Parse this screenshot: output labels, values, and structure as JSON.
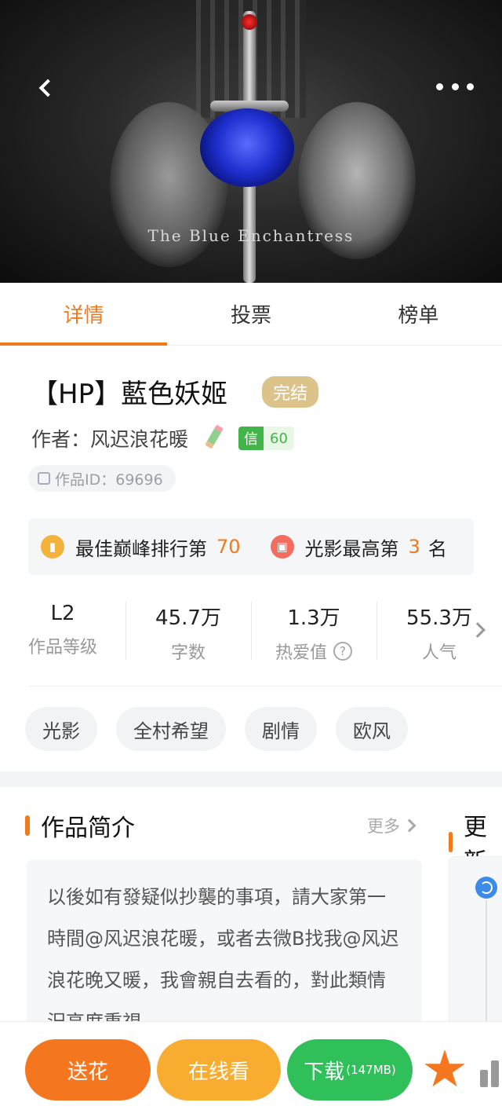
{
  "cover": {
    "title_text": "The Blue Enchantress"
  },
  "nav": {
    "back_icon": "chevron-left-icon",
    "more_icon": "more-dots-icon"
  },
  "tabs": [
    {
      "label": "详情",
      "active": true
    },
    {
      "label": "投票",
      "active": false
    },
    {
      "label": "榜单",
      "active": false
    }
  ],
  "book": {
    "title": "【HP】藍色妖姬",
    "status": "完结",
    "author_line": "作者：风迟浪花暖",
    "credit_label": "信",
    "credit_value": "60",
    "id_text": "作品ID：69696"
  },
  "ranking": {
    "peak_prefix": "最佳巅峰排行第",
    "peak_value": "70",
    "light_prefix": "光影最高第",
    "light_value": "3",
    "light_suffix": "名"
  },
  "stats": [
    {
      "value": "L2",
      "label": "作品等级"
    },
    {
      "value": "45.7万",
      "label": "字数"
    },
    {
      "value": "1.3万",
      "label": "热爱值"
    },
    {
      "value": "55.3万",
      "label": "人气"
    }
  ],
  "tags": [
    "光影",
    "全村希望",
    "剧情",
    "欧风"
  ],
  "intro": {
    "title": "作品简介",
    "more": "更多",
    "text": "以後如有發疑似抄襲的事項，請大家第一時間@风迟浪花暖，或者去微B找我@风迟浪花晚又暖，我會親自去看的，對此類情況高度重視。"
  },
  "update": {
    "title": "更新"
  },
  "bottom": {
    "flower": "送花",
    "online": "在线看",
    "download": "下载",
    "download_size": "(147MB)"
  },
  "colors": {
    "accent": "#f07a1c",
    "green": "#2fc05a",
    "yellow": "#f8ad30"
  }
}
